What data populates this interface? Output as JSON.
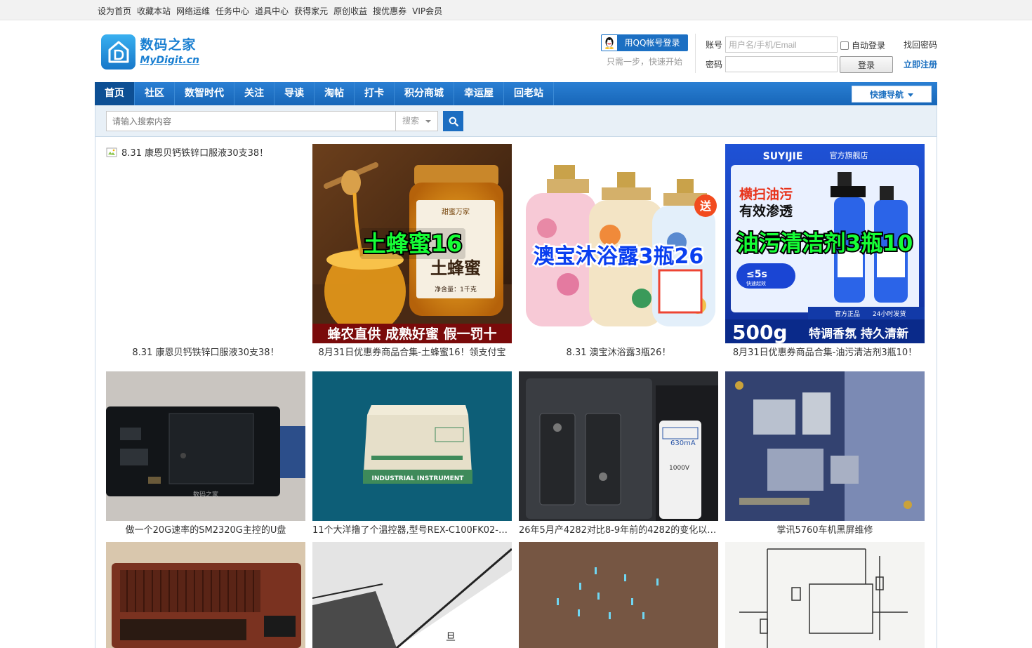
{
  "topbar": {
    "links": [
      "设为首页",
      "收藏本站",
      "网络运维",
      "任务中心",
      "道具中心",
      "获得家元",
      "原创收益",
      "搜优惠券",
      "VIP会员"
    ]
  },
  "logo": {
    "cn": "数码之家",
    "en": "MyDigit.cn"
  },
  "qq_login": {
    "label": "用QQ帐号登录",
    "sub": "只需一步，快速开始"
  },
  "login": {
    "account_label": "账号",
    "account_placeholder": "用户名/手机/Email",
    "password_label": "密码",
    "auto_login": "自动登录",
    "login_button": "登录",
    "forgot": "找回密码",
    "register": "立即注册"
  },
  "nav": {
    "items": [
      "首页",
      "社区",
      "数智时代",
      "关注",
      "导读",
      "淘帖",
      "打卡",
      "积分商城",
      "幸运屋",
      "回老站"
    ],
    "active": "首页",
    "quick_nav": "快捷导航"
  },
  "search": {
    "placeholder": "请输入搜索内容",
    "type": "搜索"
  },
  "grid": {
    "row1": [
      {
        "caption": "8.31 康恩贝钙铁锌口服液30支38！",
        "alt": "8.31 康恩贝钙铁锌口服液30支38！"
      },
      {
        "caption": "8月31日优惠券商品合集-土蜂蜜16！领支付宝",
        "overlay": "土蜂蜜16",
        "banner": "蜂农直供 成熟好蜜 假一罚十",
        "jar_brand": "甜蜜万家",
        "jar_text": "土蜂蜜",
        "jar_net": "净含量：1千克"
      },
      {
        "caption": "8.31 澳宝沐浴露3瓶26！",
        "overlay": "澳宝沐浴露3瓶26",
        "badge": "送"
      },
      {
        "caption": "8月31日优惠券商品合集-油污清洁剂3瓶10！",
        "overlay": "油污清洁剂3瓶10",
        "brand": "SUYIJIE",
        "store": "官方旗舰店",
        "headline1": "横扫油污",
        "headline2": "有效渗透",
        "badge": "≤5s",
        "badge_sub": "快速起效",
        "weight": "500g",
        "slogan": "特调香氛 持久清新",
        "tag1": "官方正品",
        "tag2": "24小时发货"
      }
    ],
    "row2": [
      {
        "caption": "做一个20G速率的SM2320G主控的U盘"
      },
      {
        "caption": "11个大洋撸了个温控器,型号REX-C100FK02-M*AN",
        "box_text": "INDUSTRIAL INSTRUMENT"
      },
      {
        "caption": "26年5月产4282对比8-9年前的4282的变化以及..."
      },
      {
        "caption": "掌讯5760车机黑屏维修"
      }
    ],
    "row3": [
      {},
      {},
      {},
      {}
    ]
  },
  "colors": {
    "nav_blue": "#1a6fc0",
    "accent": "#1b6dc1"
  }
}
